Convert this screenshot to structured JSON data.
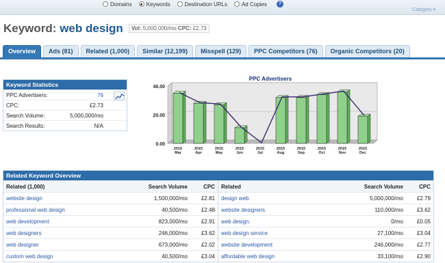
{
  "search_types": [
    {
      "label": "Domains",
      "checked": false
    },
    {
      "label": "Keywords",
      "checked": true
    },
    {
      "label": "Destination URLs",
      "checked": false
    },
    {
      "label": "Ad Copies",
      "checked": false
    }
  ],
  "help_label": "?",
  "category_label": "Category ▾",
  "header": {
    "prefix": "Keyword:",
    "keyword": "web design",
    "vol_label": "Vol:",
    "vol_value": "5,000,000/mo",
    "cpc_label": "CPC:",
    "cpc_value": "£2.73"
  },
  "tabs": [
    {
      "label": "Overview",
      "active": true
    },
    {
      "label": "Ads (81)"
    },
    {
      "label": "Related (1,000)"
    },
    {
      "label": "Similar (12,199)"
    },
    {
      "label": "Misspell (129)"
    },
    {
      "label": "PPC Competitors (76)"
    },
    {
      "label": "Organic Competitors (20)"
    }
  ],
  "stats": {
    "title": "Keyword Statistics",
    "rows": [
      {
        "label": "PPC Advertisers:",
        "value": "76"
      },
      {
        "label": "CPC:",
        "value": "£2.73"
      },
      {
        "label": "Search Volume:",
        "value": "5,000,000/mo"
      },
      {
        "label": "Search Results:",
        "value": "N/A"
      }
    ]
  },
  "chart_data": {
    "type": "bar",
    "title": "PPC Advertisers",
    "categories": [
      "2015 Mar",
      "2015 Apr",
      "2015 May",
      "2015 Jun",
      "2015 Jul",
      "2015 Aug",
      "2015 Sep",
      "2015 Oct",
      "2015 Nov",
      "2015 Dec"
    ],
    "year_labels": [
      "2015",
      "2015",
      "2015",
      "2015",
      "2015",
      "2015",
      "2015",
      "2015",
      "2015",
      "2015"
    ],
    "month_labels": [
      "Mar",
      "Apr",
      "May",
      "Jun",
      "Jul",
      "Aug",
      "Sep",
      "Oct",
      "Nov",
      "Dec"
    ],
    "values": [
      35,
      28,
      27,
      11,
      0,
      32,
      32,
      34,
      36,
      19
    ],
    "line_values": [
      35,
      28,
      27,
      11,
      0,
      32,
      32,
      34,
      36,
      19
    ],
    "yticks": [
      "0.00",
      "20.00",
      "40.00"
    ],
    "ylim": [
      0,
      40
    ],
    "bar_color": "#8fd18a",
    "line_color": "#3b2a6b",
    "grid": true
  },
  "related": {
    "title": "Related Keyword Overview",
    "left_headers": [
      "Related (1,000)",
      "Search Volume",
      "CPC"
    ],
    "right_headers": [
      "Related",
      "Search Volume",
      "CPC"
    ],
    "left_rows": [
      [
        "website design",
        "1,500,000/mo",
        "£2.81"
      ],
      [
        "professional web design",
        "40,500/mo",
        "£2.48"
      ],
      [
        "web development",
        "823,000/mo",
        "£2.91"
      ],
      [
        "web designers",
        "246,000/mo",
        "£3.62"
      ],
      [
        "web designer",
        "673,000/mo",
        "£2.02"
      ],
      [
        "custom web design",
        "40,500/mo",
        "£3.04"
      ]
    ],
    "right_rows": [
      [
        "design web",
        "5,000,000/mo",
        "£2.79"
      ],
      [
        "website designers",
        "110,000/mo",
        "£3.62"
      ],
      [
        "web design.",
        "0/mo",
        "£0.05"
      ],
      [
        "web design service",
        "27,100/mo",
        "£3.04"
      ],
      [
        "website development",
        "246,000/mo",
        "£2.77"
      ],
      [
        "affordable web design",
        "33,100/mo",
        "£2.90"
      ]
    ]
  }
}
